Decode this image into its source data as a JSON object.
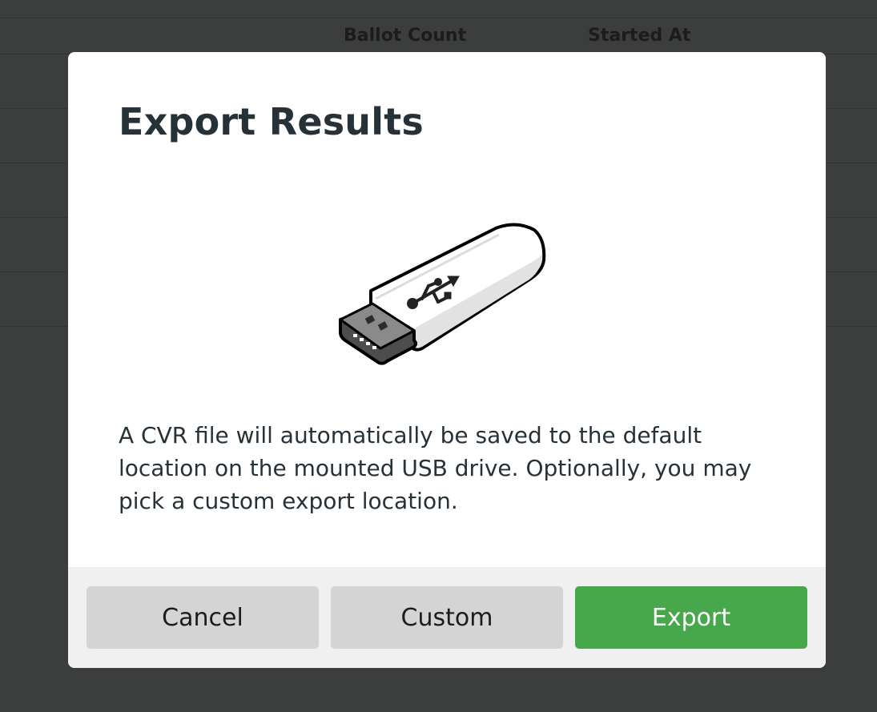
{
  "background_table": {
    "columns": [
      "Ballot Count",
      "Started At"
    ]
  },
  "modal": {
    "title": "Export Results",
    "illustration": "usb-drive-icon",
    "message": "A CVR file will automatically be saved to the default location on the mounted USB drive. Optionally, you may pick a custom export location.",
    "buttons": {
      "cancel": "Cancel",
      "custom": "Custom",
      "export": "Export"
    }
  },
  "colors": {
    "overlay_background": "#3c3e3d",
    "modal_background": "#ffffff",
    "footer_background": "#f0f0f0",
    "primary_button": "#47a74b",
    "secondary_button": "#d4d4d4",
    "text": "#263238"
  }
}
